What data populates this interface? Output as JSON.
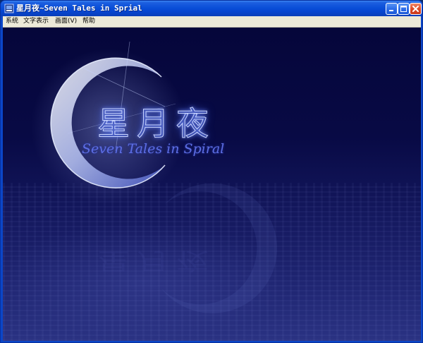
{
  "window": {
    "title": "星月夜~Seven Tales in Sprial"
  },
  "menubar": {
    "items": [
      {
        "label": "系统"
      },
      {
        "label": "文字表示"
      },
      {
        "label": "画面(V)"
      },
      {
        "label": "帮助"
      }
    ]
  },
  "logo": {
    "kanji": "星月夜",
    "subtitle": "Seven Tales in Spiral"
  },
  "icons": {
    "app": "app-icon",
    "minimize": "minimize-icon",
    "maximize": "maximize-icon",
    "close": "close-icon"
  },
  "colors": {
    "titlebar": "#0a4fd8",
    "menubar": "#ece9d8",
    "background": "#080a45",
    "logo_text": "#5d6ee4",
    "moon": "#c8d4ff"
  }
}
